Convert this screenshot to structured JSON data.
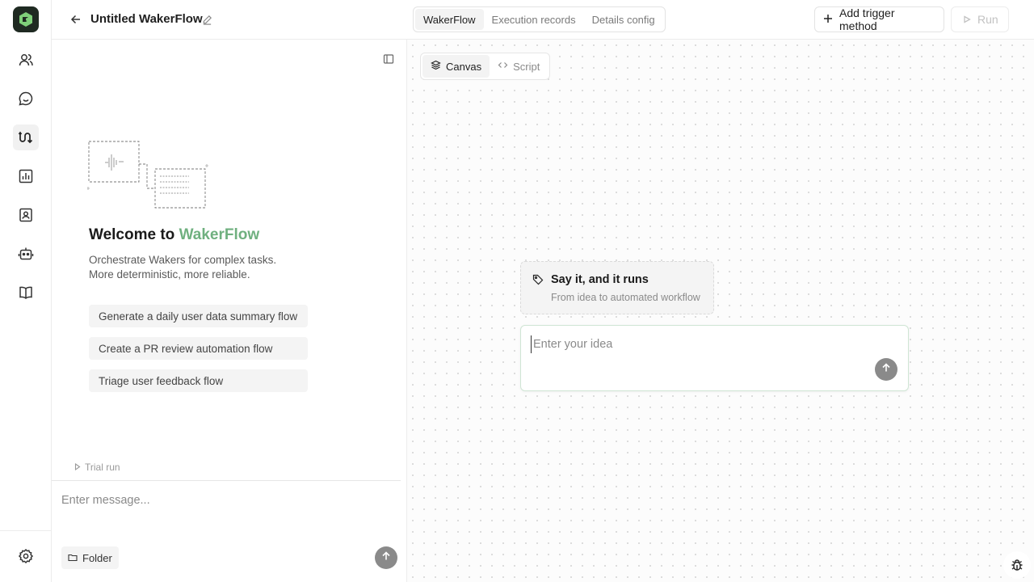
{
  "rail": {
    "logo_icon": "wakerflow-logo-icon",
    "items": [
      {
        "icon": "users-icon",
        "active": false
      },
      {
        "icon": "chat-bubble-icon",
        "active": false
      },
      {
        "icon": "workflow-icon",
        "active": true
      },
      {
        "icon": "bar-chart-icon",
        "active": false
      },
      {
        "icon": "contact-card-icon",
        "active": false
      },
      {
        "icon": "robot-icon",
        "active": false
      },
      {
        "icon": "book-icon",
        "active": false
      }
    ],
    "settings_icon": "gear-icon"
  },
  "header": {
    "title": "Untitled WakerFlow",
    "tabs": [
      {
        "label": "WakerFlow",
        "active": true
      },
      {
        "label": "Execution records",
        "active": false
      },
      {
        "label": "Details config",
        "active": false
      }
    ],
    "add_trigger_label": "Add trigger method",
    "run_label": "Run"
  },
  "chat": {
    "welcome_prefix": "Welcome to ",
    "welcome_brand": "WakerFlow",
    "tagline_line1": "Orchestrate Wakers for complex tasks.",
    "tagline_line2": "More deterministic, more reliable.",
    "suggestions": [
      "Generate a daily user data summary flow",
      "Create a PR review automation flow",
      "Triage user feedback flow"
    ],
    "trial_run_label": "Trial run",
    "message_placeholder": "Enter message...",
    "folder_label": "Folder"
  },
  "canvas": {
    "tabs": [
      {
        "label": "Canvas",
        "active": true
      },
      {
        "label": "Script",
        "active": false
      }
    ],
    "hint_title": "Say it, and it runs",
    "hint_subtitle": "From idea to automated workflow",
    "idea_placeholder": "Enter your idea"
  },
  "colors": {
    "brand_green": "#6fb07f",
    "logo_bg": "#1f2a22",
    "send_button": "#8a8a8a"
  }
}
